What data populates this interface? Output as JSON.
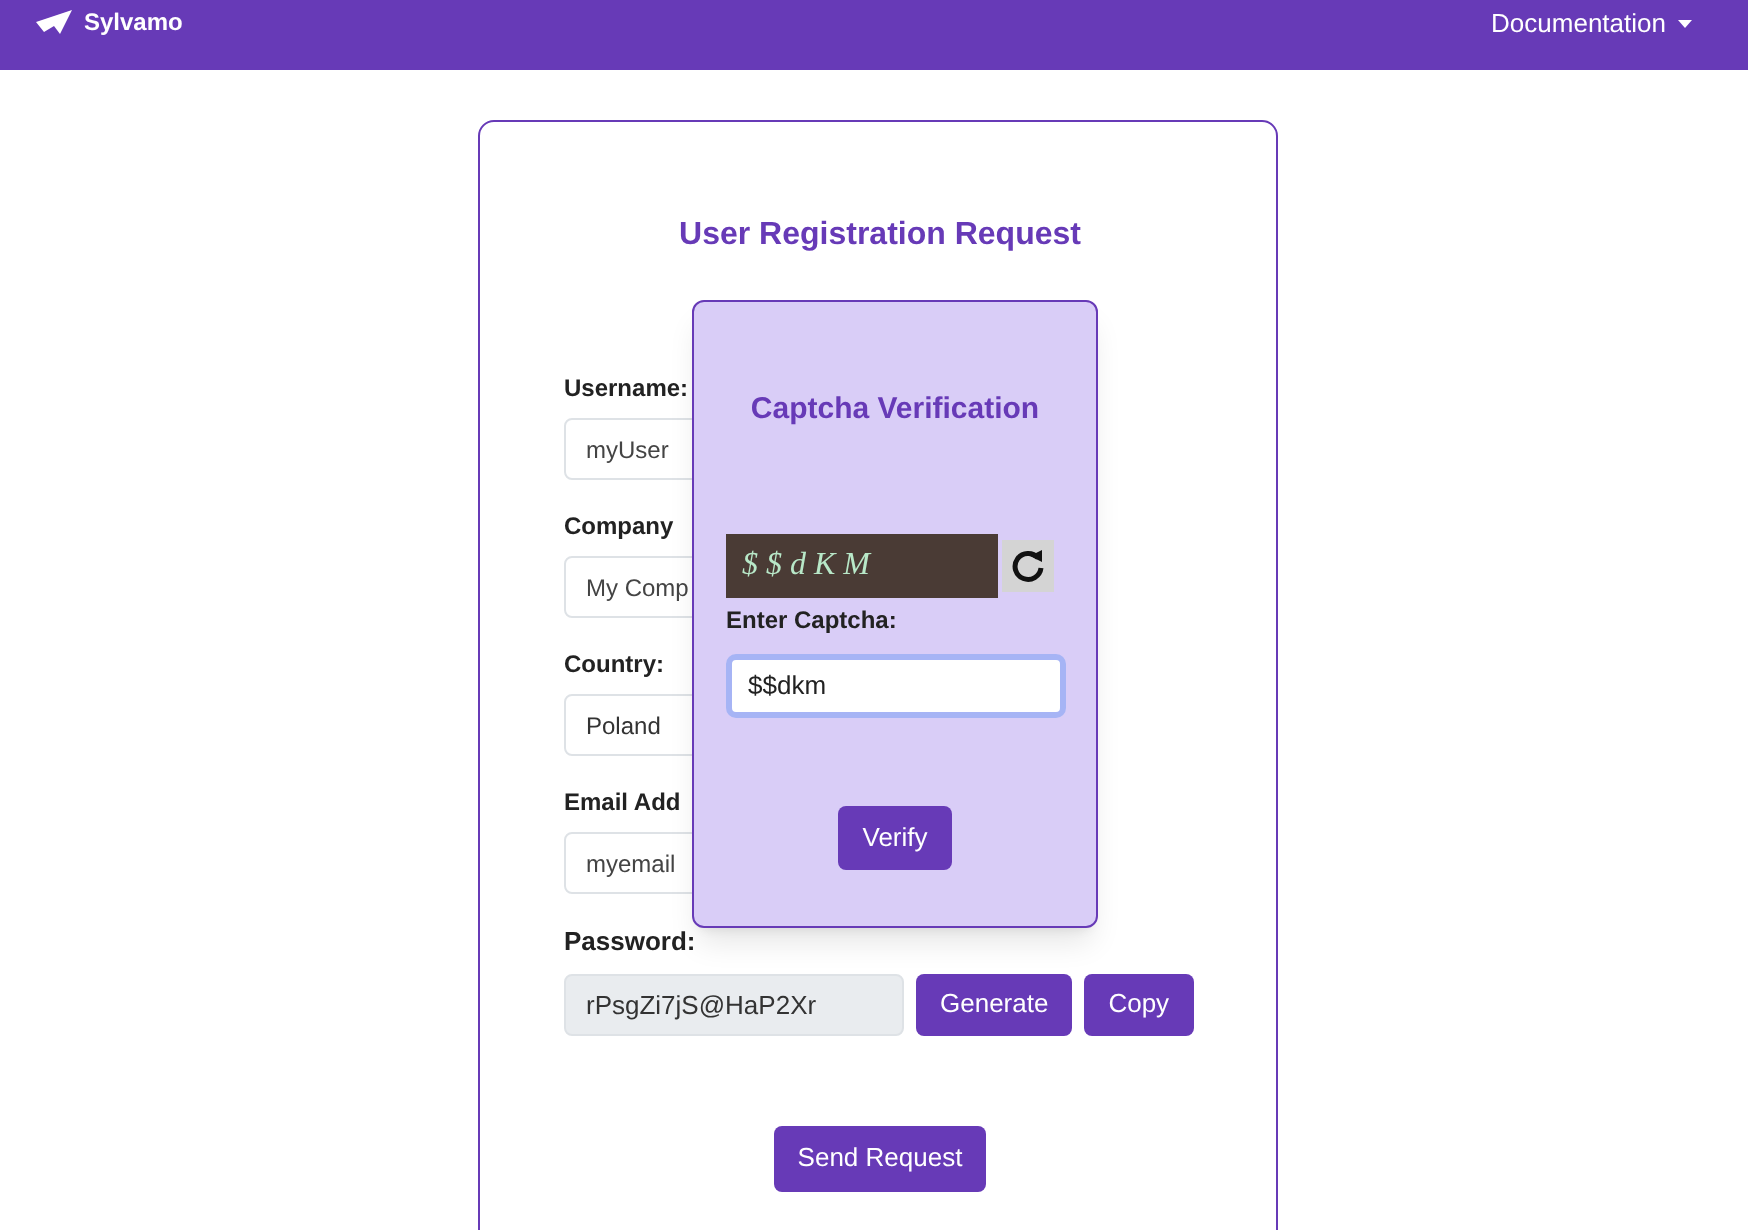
{
  "navbar": {
    "brand": "Sylvamo",
    "menu": "Documentation"
  },
  "form": {
    "title": "User Registration Request",
    "fields": [
      {
        "label": "Username:",
        "placeholder": "myUser"
      },
      {
        "label": "Company",
        "placeholder": "My Comp"
      },
      {
        "label": "Country:",
        "value": "Poland"
      },
      {
        "label": "Email Add",
        "placeholder": "myemail"
      }
    ],
    "password": {
      "label": "Password:",
      "value": "rPsgZi7jS@HaP2Xr",
      "buttons": [
        "Generate",
        "Copy"
      ]
    },
    "submit": "Send Request"
  },
  "captcha": {
    "title": "Captcha Verification",
    "image_text": "$$dKM",
    "label": "Enter Captcha:",
    "value": "$$dkm",
    "button": "Verify"
  }
}
